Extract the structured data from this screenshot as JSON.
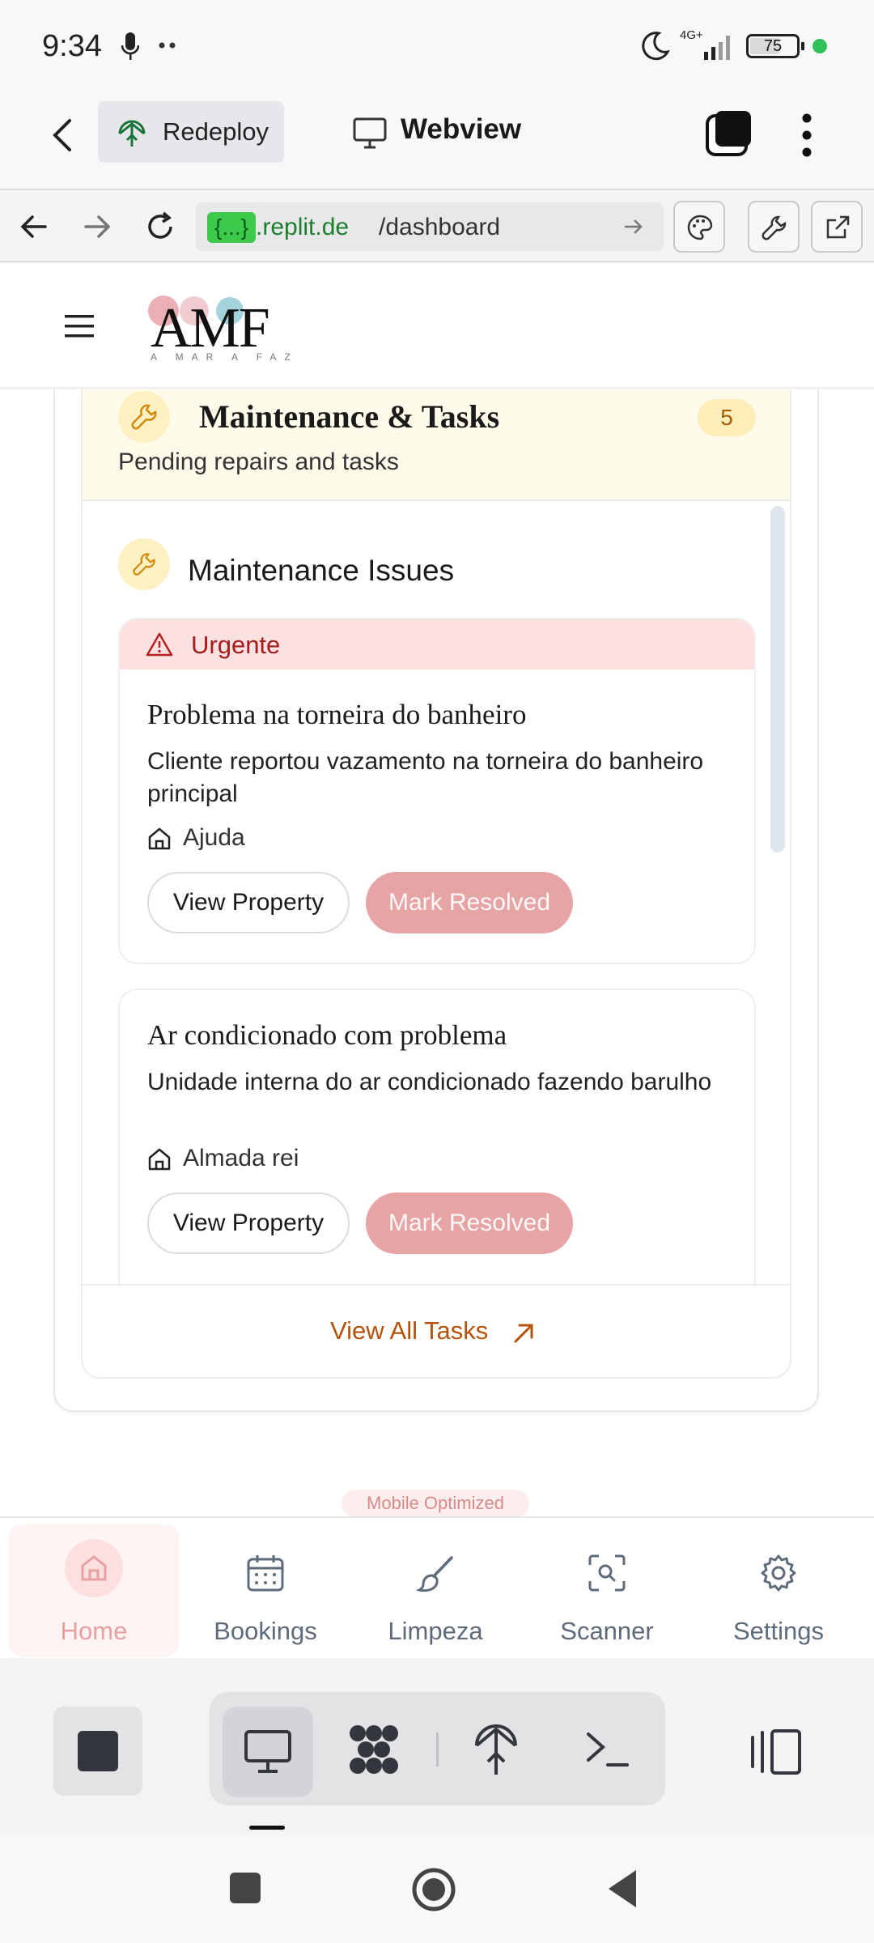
{
  "status_bar": {
    "time": "9:34",
    "network": "4G+",
    "battery": "75"
  },
  "replit_header": {
    "redeploy_label": "Redeploy",
    "webview_label": "Webview"
  },
  "browser": {
    "url_chip": "{...}",
    "url_host": ".replit.de",
    "url_path": "/dashboard"
  },
  "app": {
    "logo": "AMF",
    "logo_tagline": "A MAR A FAZ"
  },
  "tasks_card": {
    "title": "Maintenance & Tasks",
    "subtitle": "Pending repairs and tasks",
    "count": "5",
    "section_title": "Maintenance Issues",
    "issues": [
      {
        "priority": "Urgente",
        "title": "Problema na torneira do banheiro",
        "description": "Cliente reportou vazamento na torneira do banheiro principal",
        "property": "Ajuda",
        "view_label": "View Property",
        "resolve_label": "Mark Resolved"
      },
      {
        "title": "Ar condicionado com problema",
        "description": "Unidade interna do ar condicionado fazendo barulho",
        "property": "Almada rei",
        "view_label": "View Property",
        "resolve_label": "Mark Resolved"
      }
    ],
    "view_all_label": "View All Tasks"
  },
  "mobile_badge": "Mobile Optimized",
  "bottom_nav": [
    {
      "label": "Home",
      "icon": "home-icon",
      "active": true
    },
    {
      "label": "Bookings",
      "icon": "calendar-icon"
    },
    {
      "label": "Limpeza",
      "icon": "brush-icon"
    },
    {
      "label": "Scanner",
      "icon": "scan-icon"
    },
    {
      "label": "Settings",
      "icon": "gear-icon"
    }
  ],
  "colors": {
    "accent": "#b45309",
    "urgent": "#a61b1b",
    "resolve_button": "#e7a4a4",
    "home_active": "#e8a0a0"
  }
}
